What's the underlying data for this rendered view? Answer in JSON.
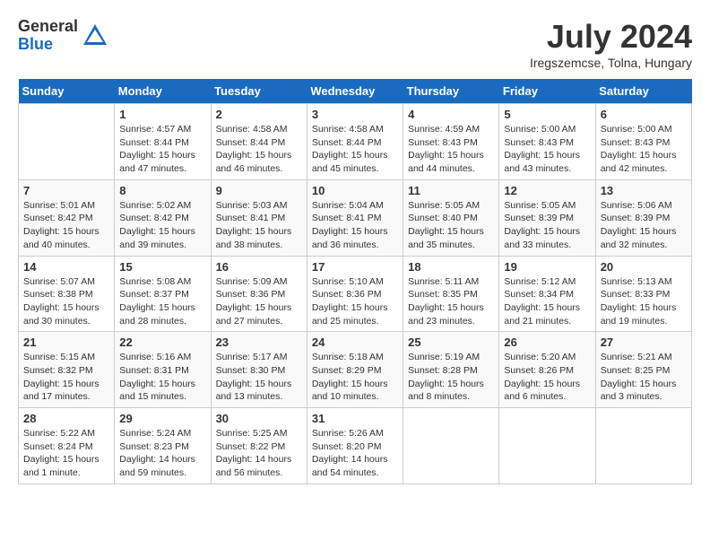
{
  "header": {
    "logo_general": "General",
    "logo_blue": "Blue",
    "month_title": "July 2024",
    "subtitle": "Iregszemcse, Tolna, Hungary"
  },
  "columns": [
    "Sunday",
    "Monday",
    "Tuesday",
    "Wednesday",
    "Thursday",
    "Friday",
    "Saturday"
  ],
  "weeks": [
    [
      {
        "day": "",
        "info": ""
      },
      {
        "day": "1",
        "info": "Sunrise: 4:57 AM\nSunset: 8:44 PM\nDaylight: 15 hours\nand 47 minutes."
      },
      {
        "day": "2",
        "info": "Sunrise: 4:58 AM\nSunset: 8:44 PM\nDaylight: 15 hours\nand 46 minutes."
      },
      {
        "day": "3",
        "info": "Sunrise: 4:58 AM\nSunset: 8:44 PM\nDaylight: 15 hours\nand 45 minutes."
      },
      {
        "day": "4",
        "info": "Sunrise: 4:59 AM\nSunset: 8:43 PM\nDaylight: 15 hours\nand 44 minutes."
      },
      {
        "day": "5",
        "info": "Sunrise: 5:00 AM\nSunset: 8:43 PM\nDaylight: 15 hours\nand 43 minutes."
      },
      {
        "day": "6",
        "info": "Sunrise: 5:00 AM\nSunset: 8:43 PM\nDaylight: 15 hours\nand 42 minutes."
      }
    ],
    [
      {
        "day": "7",
        "info": "Sunrise: 5:01 AM\nSunset: 8:42 PM\nDaylight: 15 hours\nand 40 minutes."
      },
      {
        "day": "8",
        "info": "Sunrise: 5:02 AM\nSunset: 8:42 PM\nDaylight: 15 hours\nand 39 minutes."
      },
      {
        "day": "9",
        "info": "Sunrise: 5:03 AM\nSunset: 8:41 PM\nDaylight: 15 hours\nand 38 minutes."
      },
      {
        "day": "10",
        "info": "Sunrise: 5:04 AM\nSunset: 8:41 PM\nDaylight: 15 hours\nand 36 minutes."
      },
      {
        "day": "11",
        "info": "Sunrise: 5:05 AM\nSunset: 8:40 PM\nDaylight: 15 hours\nand 35 minutes."
      },
      {
        "day": "12",
        "info": "Sunrise: 5:05 AM\nSunset: 8:39 PM\nDaylight: 15 hours\nand 33 minutes."
      },
      {
        "day": "13",
        "info": "Sunrise: 5:06 AM\nSunset: 8:39 PM\nDaylight: 15 hours\nand 32 minutes."
      }
    ],
    [
      {
        "day": "14",
        "info": "Sunrise: 5:07 AM\nSunset: 8:38 PM\nDaylight: 15 hours\nand 30 minutes."
      },
      {
        "day": "15",
        "info": "Sunrise: 5:08 AM\nSunset: 8:37 PM\nDaylight: 15 hours\nand 28 minutes."
      },
      {
        "day": "16",
        "info": "Sunrise: 5:09 AM\nSunset: 8:36 PM\nDaylight: 15 hours\nand 27 minutes."
      },
      {
        "day": "17",
        "info": "Sunrise: 5:10 AM\nSunset: 8:36 PM\nDaylight: 15 hours\nand 25 minutes."
      },
      {
        "day": "18",
        "info": "Sunrise: 5:11 AM\nSunset: 8:35 PM\nDaylight: 15 hours\nand 23 minutes."
      },
      {
        "day": "19",
        "info": "Sunrise: 5:12 AM\nSunset: 8:34 PM\nDaylight: 15 hours\nand 21 minutes."
      },
      {
        "day": "20",
        "info": "Sunrise: 5:13 AM\nSunset: 8:33 PM\nDaylight: 15 hours\nand 19 minutes."
      }
    ],
    [
      {
        "day": "21",
        "info": "Sunrise: 5:15 AM\nSunset: 8:32 PM\nDaylight: 15 hours\nand 17 minutes."
      },
      {
        "day": "22",
        "info": "Sunrise: 5:16 AM\nSunset: 8:31 PM\nDaylight: 15 hours\nand 15 minutes."
      },
      {
        "day": "23",
        "info": "Sunrise: 5:17 AM\nSunset: 8:30 PM\nDaylight: 15 hours\nand 13 minutes."
      },
      {
        "day": "24",
        "info": "Sunrise: 5:18 AM\nSunset: 8:29 PM\nDaylight: 15 hours\nand 10 minutes."
      },
      {
        "day": "25",
        "info": "Sunrise: 5:19 AM\nSunset: 8:28 PM\nDaylight: 15 hours\nand 8 minutes."
      },
      {
        "day": "26",
        "info": "Sunrise: 5:20 AM\nSunset: 8:26 PM\nDaylight: 15 hours\nand 6 minutes."
      },
      {
        "day": "27",
        "info": "Sunrise: 5:21 AM\nSunset: 8:25 PM\nDaylight: 15 hours\nand 3 minutes."
      }
    ],
    [
      {
        "day": "28",
        "info": "Sunrise: 5:22 AM\nSunset: 8:24 PM\nDaylight: 15 hours\nand 1 minute."
      },
      {
        "day": "29",
        "info": "Sunrise: 5:24 AM\nSunset: 8:23 PM\nDaylight: 14 hours\nand 59 minutes."
      },
      {
        "day": "30",
        "info": "Sunrise: 5:25 AM\nSunset: 8:22 PM\nDaylight: 14 hours\nand 56 minutes."
      },
      {
        "day": "31",
        "info": "Sunrise: 5:26 AM\nSunset: 8:20 PM\nDaylight: 14 hours\nand 54 minutes."
      },
      {
        "day": "",
        "info": ""
      },
      {
        "day": "",
        "info": ""
      },
      {
        "day": "",
        "info": ""
      }
    ]
  ]
}
